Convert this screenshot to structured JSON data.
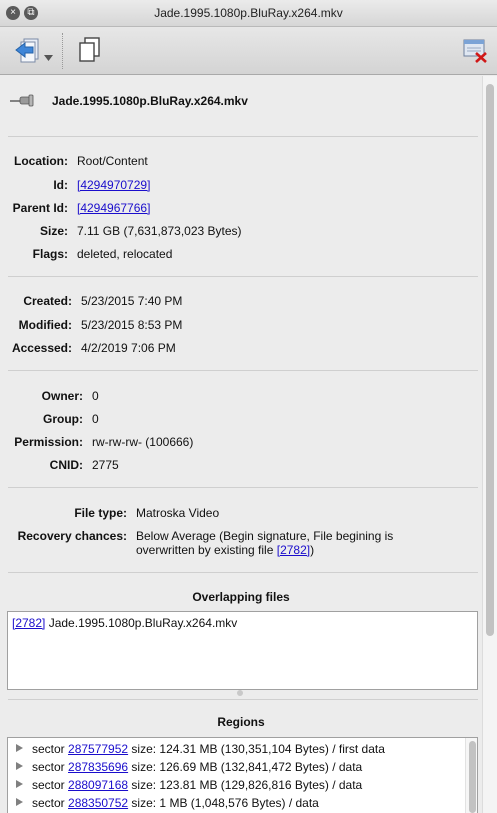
{
  "window": {
    "title": "Jade.1995.1080p.BluRay.x264.mkv",
    "close_glyph": "×",
    "min_glyph": "⧉"
  },
  "toolbar": {
    "icons": [
      "back-navigation-icon",
      "dropdown-arrow-icon",
      "copy-documents-icon",
      "delete-window-icon"
    ]
  },
  "file": {
    "name": "Jade.1995.1080p.BluRay.x264.mkv",
    "icon": "pin-icon"
  },
  "general": {
    "location_label": "Location:",
    "location_value": "Root/Content",
    "id_label": "Id:",
    "id_value": "[4294970729]",
    "parent_id_label": "Parent Id:",
    "parent_id_value": "[4294967766]",
    "size_label": "Size:",
    "size_value": "7.11 GB (7,631,873,023 Bytes)",
    "flags_label": "Flags:",
    "flags_value": "deleted, relocated"
  },
  "dates": {
    "created_label": "Created:",
    "created_value": "5/23/2015 7:40 PM",
    "modified_label": "Modified:",
    "modified_value": "5/23/2015 8:53 PM",
    "accessed_label": "Accessed:",
    "accessed_value": "4/2/2019 7:06 PM"
  },
  "ownership": {
    "owner_label": "Owner:",
    "owner_value": "0",
    "group_label": "Group:",
    "group_value": "0",
    "permission_label": "Permission:",
    "permission_value": "rw-rw-rw- (100666)",
    "cnid_label": "CNID:",
    "cnid_value": "2775"
  },
  "recovery": {
    "file_type_label": "File type:",
    "file_type_value": "Matroska Video",
    "chances_label": "Recovery chances:",
    "chances_line1": "Below Average (Begin signature, File begining is",
    "chances_line2": "overwritten by existing file ",
    "chances_link": "[2782]",
    "chances_end": ")"
  },
  "overlapping": {
    "title": "Overlapping files",
    "items": [
      {
        "link": "[2782]",
        "name": " Jade.1995.1080p.BluRay.x264.mkv"
      }
    ]
  },
  "regions": {
    "title": "Regions",
    "items": [
      {
        "prefix": "sector ",
        "sector": "287577952",
        "rest": " size: 124.31 MB (130,351,104 Bytes) / first data"
      },
      {
        "prefix": "sector ",
        "sector": "287835696",
        "rest": " size: 126.69 MB (132,841,472 Bytes) / data"
      },
      {
        "prefix": "sector ",
        "sector": "288097168",
        "rest": " size: 123.81 MB (129,826,816 Bytes) / data"
      },
      {
        "prefix": "sector ",
        "sector": "288350752",
        "rest": " size: 1 MB (1,048,576 Bytes) / data"
      }
    ]
  }
}
